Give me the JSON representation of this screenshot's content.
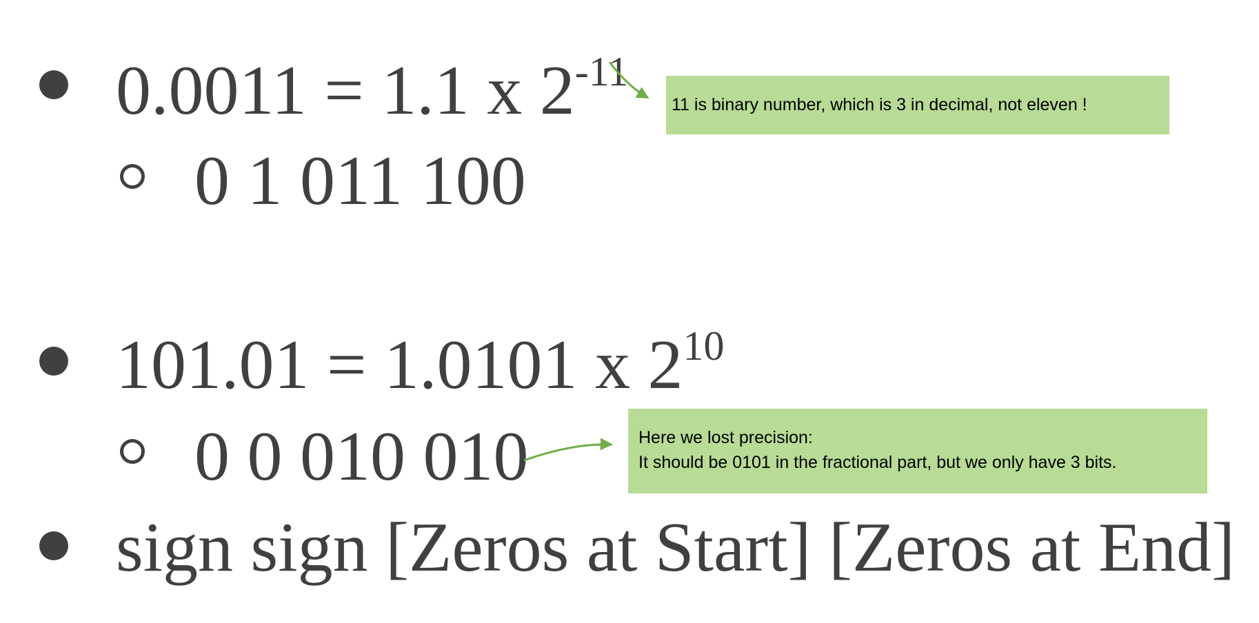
{
  "items": [
    {
      "main": "0.0011 = 1.1 x 2",
      "exponent": "-11",
      "sub": "0 1 011 100"
    },
    {
      "main": "101.01 = 1.0101 x 2",
      "exponent": "10",
      "sub": "0 0 010 010"
    },
    {
      "main": "sign sign [Zeros at Start] [Zeros at End]"
    }
  ],
  "notes": [
    {
      "lines": [
        "11 is binary number, which is 3 in decimal, not eleven !"
      ]
    },
    {
      "lines": [
        "Here we lost precision:",
        "It should be 0101 in the fractional part, but we only have 3 bits."
      ]
    }
  ],
  "colors": {
    "text": "#404040",
    "note_fill": "#b8db95",
    "arrow": "#70ad47"
  }
}
